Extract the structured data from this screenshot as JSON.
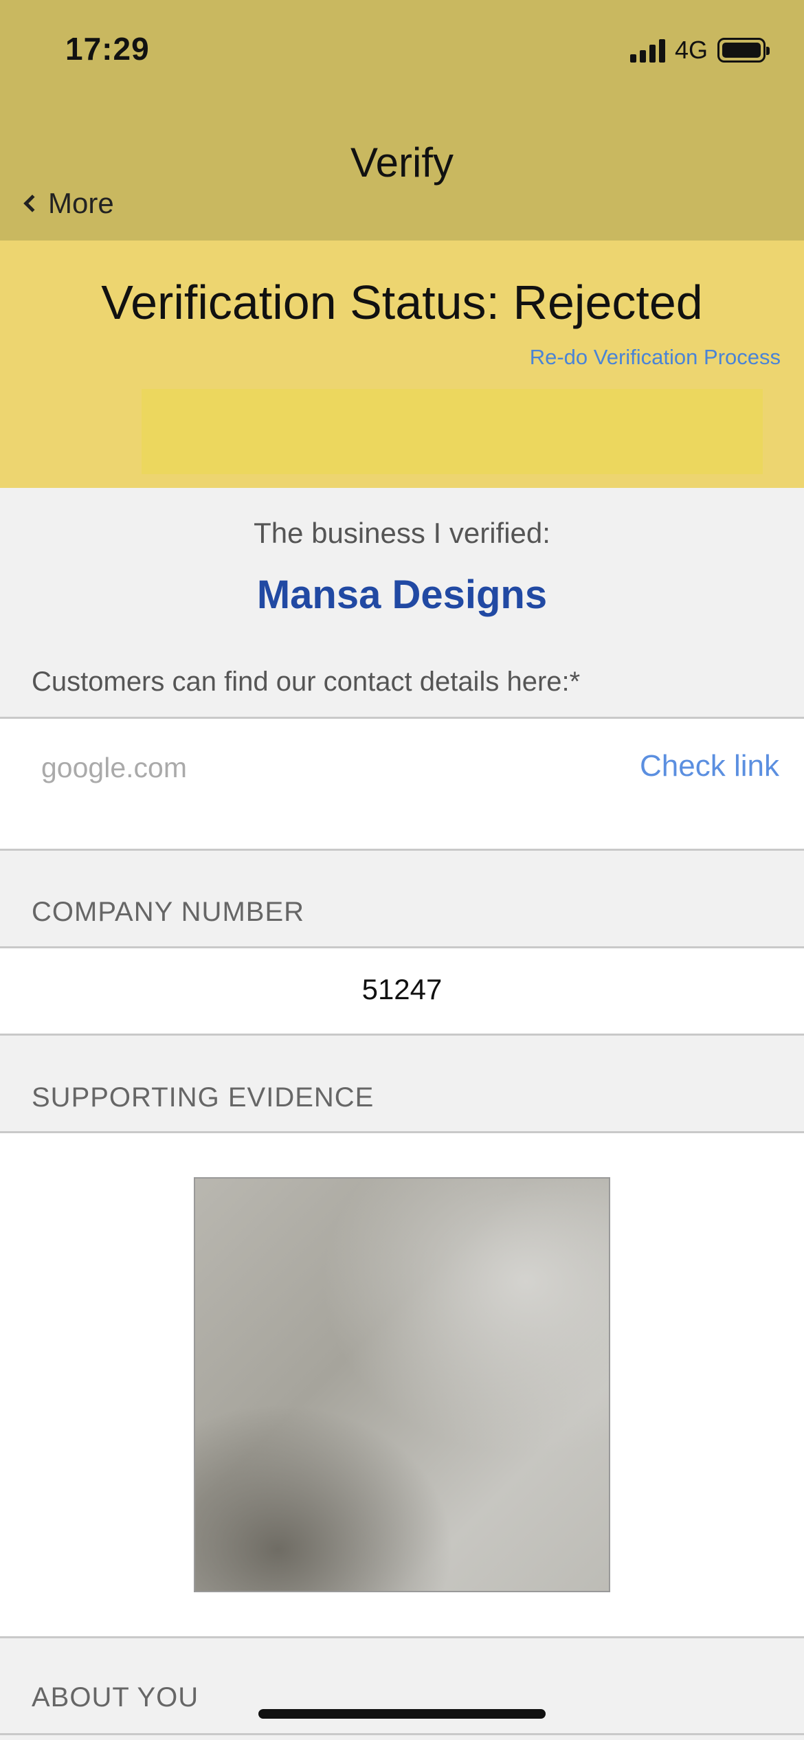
{
  "status_bar": {
    "time": "17:29",
    "network": "4G",
    "icons": [
      "signal-icon",
      "battery-icon"
    ]
  },
  "nav": {
    "title": "Verify",
    "back_label": "More",
    "back_icon": "chevron-left-icon"
  },
  "banner": {
    "title": "Verification Status: Rejected",
    "redo_link": "Re-do Verification Process"
  },
  "business": {
    "label": "The business I verified:",
    "name": "Mansa Designs"
  },
  "contact": {
    "label": "Customers can find our contact details here:*",
    "input_value": "google.com",
    "check_link": "Check link"
  },
  "company_number": {
    "header": "COMPANY NUMBER",
    "value": "51247"
  },
  "supporting_evidence": {
    "header": "SUPPORTING EVIDENCE"
  },
  "about_you": {
    "header": "ABOUT YOU"
  },
  "colors": {
    "nav_bg": "#c9b860",
    "banner_bg": "#edd570",
    "link_blue": "#4a84d6",
    "business_name": "#2149a3"
  }
}
